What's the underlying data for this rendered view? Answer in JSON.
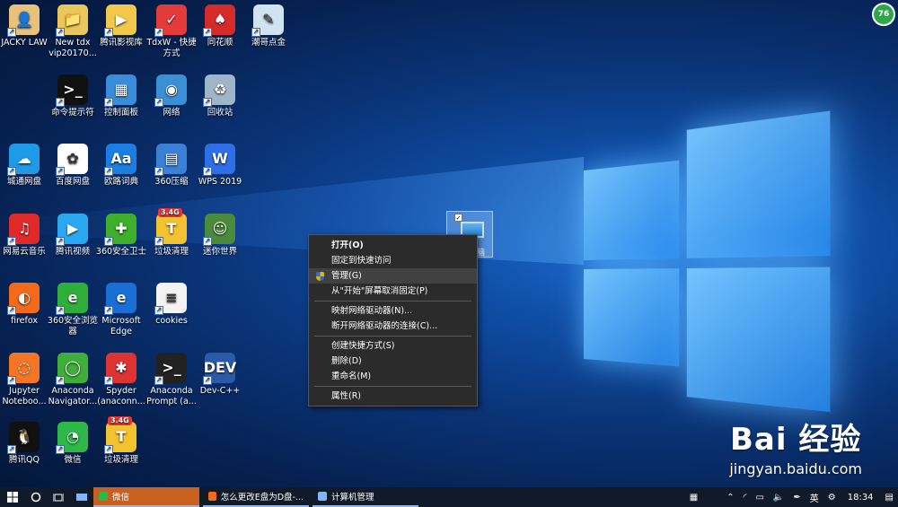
{
  "desktop": {
    "icons": [
      {
        "label": "JACKY LAW",
        "color": "#e8c27a",
        "glyph": "👤"
      },
      {
        "label": "New tdx vip20170...",
        "color": "#e9c75a",
        "glyph": "📁"
      },
      {
        "label": "腾讯影视库",
        "color": "#f1c84a",
        "glyph": "▶"
      },
      {
        "label": "TdxW - 快捷方式",
        "color": "#e33a3a",
        "glyph": "✓"
      },
      {
        "label": "同花顺",
        "color": "#d62b2b",
        "glyph": "♠"
      },
      {
        "label": "潮哥点金",
        "color": "#cfe3f1",
        "glyph": "✎"
      },
      {
        "label": "命令提示符",
        "color": "#111111",
        "glyph": ">_"
      },
      {
        "label": "控制面板",
        "color": "#3b8ddb",
        "glyph": "▦"
      },
      {
        "label": "网络",
        "color": "#3a8fd6",
        "glyph": "◉"
      },
      {
        "label": "回收站",
        "color": "#9fb5c8",
        "glyph": "♻"
      },
      {
        "label": "城通网盘",
        "color": "#1f9ae6",
        "glyph": "☁"
      },
      {
        "label": "百度网盘",
        "color": "#ffffff",
        "glyph": "✿"
      },
      {
        "label": "欧路词典",
        "color": "#1a7fe0",
        "glyph": "Aa"
      },
      {
        "label": "360压缩",
        "color": "#3b7fd6",
        "glyph": "▤"
      },
      {
        "label": "WPS 2019",
        "color": "#2e6fe8",
        "glyph": "W"
      },
      {
        "label": "网易云音乐",
        "color": "#e02a2a",
        "glyph": "♫"
      },
      {
        "label": "腾讯视频",
        "color": "#2aa8f0",
        "glyph": "▶"
      },
      {
        "label": "360安全卫士",
        "color": "#3fae2a",
        "glyph": "✚"
      },
      {
        "label": "垃圾清理",
        "color": "#f2c230",
        "glyph": "T",
        "badge": "3.4G"
      },
      {
        "label": "迷你世界",
        "color": "#4a8a3a",
        "glyph": "☺"
      },
      {
        "label": "firefox",
        "color": "#f26a1a",
        "glyph": "◐"
      },
      {
        "label": "360安全浏览器",
        "color": "#2fae3a",
        "glyph": "e"
      },
      {
        "label": "Microsoft Edge",
        "color": "#1a6fd6",
        "glyph": "e"
      },
      {
        "label": "cookies",
        "color": "#f3f3f3",
        "glyph": "≡"
      },
      {
        "label": "Jupyter Noteboo...",
        "color": "#f37626",
        "glyph": "◌"
      },
      {
        "label": "Anaconda Navigator...",
        "color": "#3fae3a",
        "glyph": "◯"
      },
      {
        "label": "Spyder (anaconn...",
        "color": "#d33",
        "glyph": "✱"
      },
      {
        "label": "Anaconda Prompt (a...",
        "color": "#222222",
        "glyph": ">_"
      },
      {
        "label": "Dev-C++",
        "color": "#2a5aa8",
        "glyph": "DEV"
      },
      {
        "label": "腾讯QQ",
        "color": "#111111",
        "glyph": "🐧"
      },
      {
        "label": "微信",
        "color": "#2fb84a",
        "glyph": "◔"
      },
      {
        "label": "垃圾清理",
        "color": "#f2c230",
        "glyph": "T",
        "badge": "3.4G"
      }
    ],
    "selected_icon_label_fragment": "脑"
  },
  "context_menu": {
    "items": [
      {
        "label": "打开(O)",
        "bold": true
      },
      {
        "label": "固定到快速访问"
      },
      {
        "label": "管理(G)",
        "highlight": true,
        "shield": true
      },
      {
        "label": "从\"开始\"屏幕取消固定(P)"
      },
      {
        "sep": true
      },
      {
        "label": "映射网络驱动器(N)..."
      },
      {
        "label": "断开网络驱动器的连接(C)..."
      },
      {
        "sep": true
      },
      {
        "label": "创建快捷方式(S)"
      },
      {
        "label": "删除(D)"
      },
      {
        "label": "重命名(M)"
      },
      {
        "sep": true
      },
      {
        "label": "属性(R)"
      }
    ]
  },
  "taskbar": {
    "apps": [
      {
        "label": "微信",
        "active": true
      },
      {
        "label": "怎么更改E盘为D盘-..."
      },
      {
        "label": "计算机管理"
      }
    ],
    "ime": "英",
    "time": "18:34"
  },
  "watermark": {
    "logo": "Bai 经验",
    "url": "jingyan.baidu.com"
  },
  "corner_badge": "76"
}
